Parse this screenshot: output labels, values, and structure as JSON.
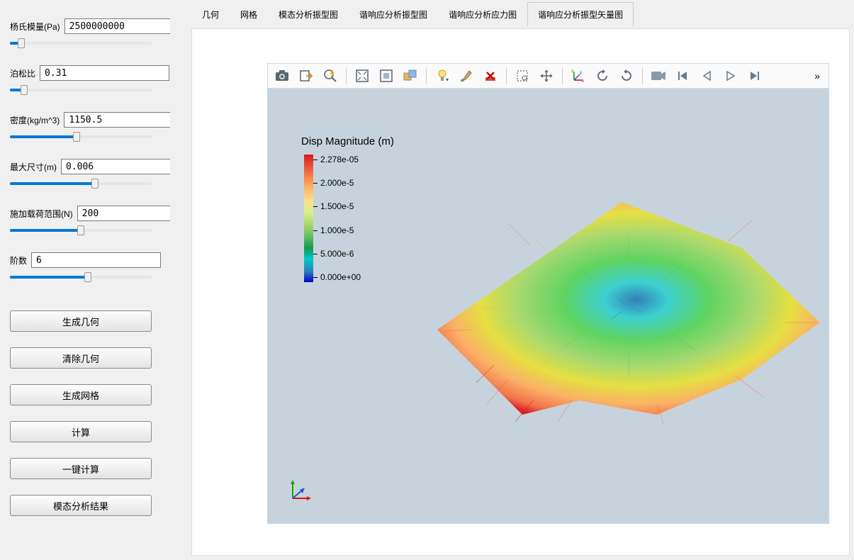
{
  "sidebar": {
    "params": [
      {
        "label": "杨氏模量(Pa)",
        "value": "2500000000",
        "fillPct": 8
      },
      {
        "label": "泊松比",
        "value": "0.31",
        "fillPct": 10
      },
      {
        "label": "密度(kg/m^3)",
        "value": "1150.5",
        "fillPct": 47
      },
      {
        "label": "最大尺寸(m)",
        "value": "0.006",
        "fillPct": 60
      },
      {
        "label": "施加载荷范围(N)",
        "value": "200",
        "fillPct": 50
      },
      {
        "label": "阶数",
        "value": "6",
        "fillPct": 55
      }
    ],
    "buttons": {
      "gen_geom": "生成几何",
      "clear_geom": "清除几何",
      "gen_mesh": "生成网格",
      "compute": "计算",
      "one_click": "一键计算",
      "modal_result": "模态分析结果"
    }
  },
  "tabs": {
    "items": [
      "几何",
      "网格",
      "模态分析振型图",
      "谐响应分析振型图",
      "谐响应分析应力图",
      "谐响应分析振型矢量图"
    ],
    "activeIndex": 5
  },
  "toolbar": {
    "more": "»"
  },
  "chart_data": {
    "type": "heatmap",
    "title": "Disp Magnitude (m)",
    "colorbar_ticks": [
      "2.278e-05",
      "2.000e-5",
      "1.500e-5",
      "1.000e-5",
      "5.000e-6",
      "0.000e+00"
    ],
    "value_range": [
      0.0,
      2.278e-05
    ],
    "units": "m",
    "description": "3D vector glyph plot of displacement magnitude on a deformed plate; center near zero (blue), edges/corners high (orange/red)."
  }
}
